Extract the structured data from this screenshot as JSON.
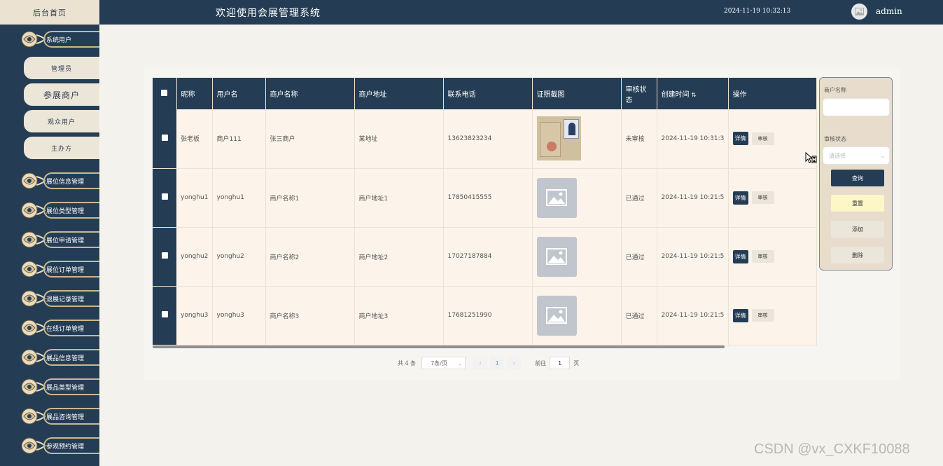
{
  "sidebar": {
    "home": "后台首页",
    "group_title": "系统用户",
    "sub_items": [
      {
        "label": "管理员"
      },
      {
        "label": "参展商户"
      },
      {
        "label": "观众用户"
      },
      {
        "label": "主办方"
      }
    ],
    "menu": [
      {
        "label": "展位信息管理"
      },
      {
        "label": "展位类型管理"
      },
      {
        "label": "展位申请管理"
      },
      {
        "label": "展位订单管理"
      },
      {
        "label": "退展记录管理"
      },
      {
        "label": "在线订单管理"
      },
      {
        "label": "展品信息管理"
      },
      {
        "label": "展品类型管理"
      },
      {
        "label": "展品咨询管理"
      },
      {
        "label": "参观预约管理"
      }
    ]
  },
  "header": {
    "title": "欢迎使用会展管理系统",
    "datetime": "2024-11-19 10:32:13",
    "user": "admin",
    "avatar_icon": "image-icon"
  },
  "table": {
    "columns": [
      "昵称",
      "用户名",
      "商户名称",
      "商户地址",
      "联系电话",
      "证照截图",
      "审核状态",
      "创建时间",
      "操作"
    ],
    "rows": [
      {
        "nickname": "张老板",
        "username": "商户111",
        "merchant": "张三商户",
        "address": "某地址",
        "phone": "13623823234",
        "image": "photo",
        "status": "未审核",
        "created": "2024-11-19 10:31:3"
      },
      {
        "nickname": "yonghu1",
        "username": "yonghu1",
        "merchant": "商户名称1",
        "address": "商户地址1",
        "phone": "17850415555",
        "image": "placeholder",
        "status": "已通过",
        "created": "2024-11-19 10:21:5"
      },
      {
        "nickname": "yonghu2",
        "username": "yonghu2",
        "merchant": "商户名称2",
        "address": "商户地址2",
        "phone": "17027187884",
        "image": "placeholder",
        "status": "已通过",
        "created": "2024-11-19 10:21:5"
      },
      {
        "nickname": "yonghu3",
        "username": "yonghu3",
        "merchant": "商户名称3",
        "address": "商户地址3",
        "phone": "17681251990",
        "image": "placeholder",
        "status": "已通过",
        "created": "2024-11-19 10:21:5"
      }
    ],
    "detail_label": "详情",
    "audit_label": "审核"
  },
  "pager": {
    "total": "共 4 条",
    "page_size": "7条/页",
    "current": "1",
    "goto_prefix": "前往",
    "goto_value": "1",
    "goto_suffix": "页"
  },
  "search": {
    "merchant_label": "商户名称",
    "status_label": "审核状态",
    "status_placeholder": "请选择",
    "query": "查询",
    "reset": "重置",
    "add": "添加",
    "delete": "删除"
  },
  "watermark": "CSDN @vx_CXKF10088",
  "colors": {
    "primary": "#243d55",
    "row_bg": "#fcf3ea",
    "panel_bg": "#e8ddcc",
    "page_bg": "#f3f2ec"
  }
}
